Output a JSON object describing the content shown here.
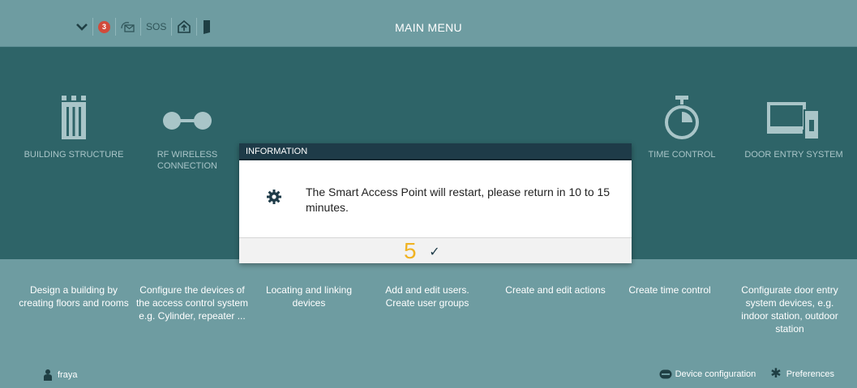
{
  "topbar": {
    "title": "MAIN MENU",
    "notification_count": "3",
    "sos_label": "SOS"
  },
  "tiles": [
    {
      "name": "building-structure",
      "label": "BUILDING STRUCTURE",
      "description": "Design a building by creating floors and rooms"
    },
    {
      "name": "rf-wireless-connection",
      "label": "RF WIRELESS CONNECTION",
      "description": "Configure the devices of the access control system e.g. Cylinder, repeater ..."
    },
    {
      "name": "device-assignment",
      "label": "",
      "description": "Locating and linking devices"
    },
    {
      "name": "user-management",
      "label": "",
      "description": "Add and edit users. Create user groups"
    },
    {
      "name": "actions",
      "label": "",
      "description": "Create and edit actions"
    },
    {
      "name": "time-control",
      "label": "TIME CONTROL",
      "description": "Create time control"
    },
    {
      "name": "door-entry-system",
      "label": "DOOR ENTRY SYSTEM",
      "description": "Configurate door entry system devices, e.g. indoor station, outdoor station"
    }
  ],
  "footer": {
    "user_name": "fraya",
    "device_configuration_label": "Device configuration",
    "preferences_label": "Preferences"
  },
  "modal": {
    "title": "INFORMATION",
    "message": "The Smart Access Point will restart, please return in 10 to 15 minutes.",
    "countdown": "5",
    "confirm_symbol": "✓"
  },
  "colors": {
    "background": "#6e9ca1",
    "band": "#2e6468",
    "modal_header": "#1e3b48",
    "countdown": "#f0b323",
    "badge": "#d24b3b"
  }
}
